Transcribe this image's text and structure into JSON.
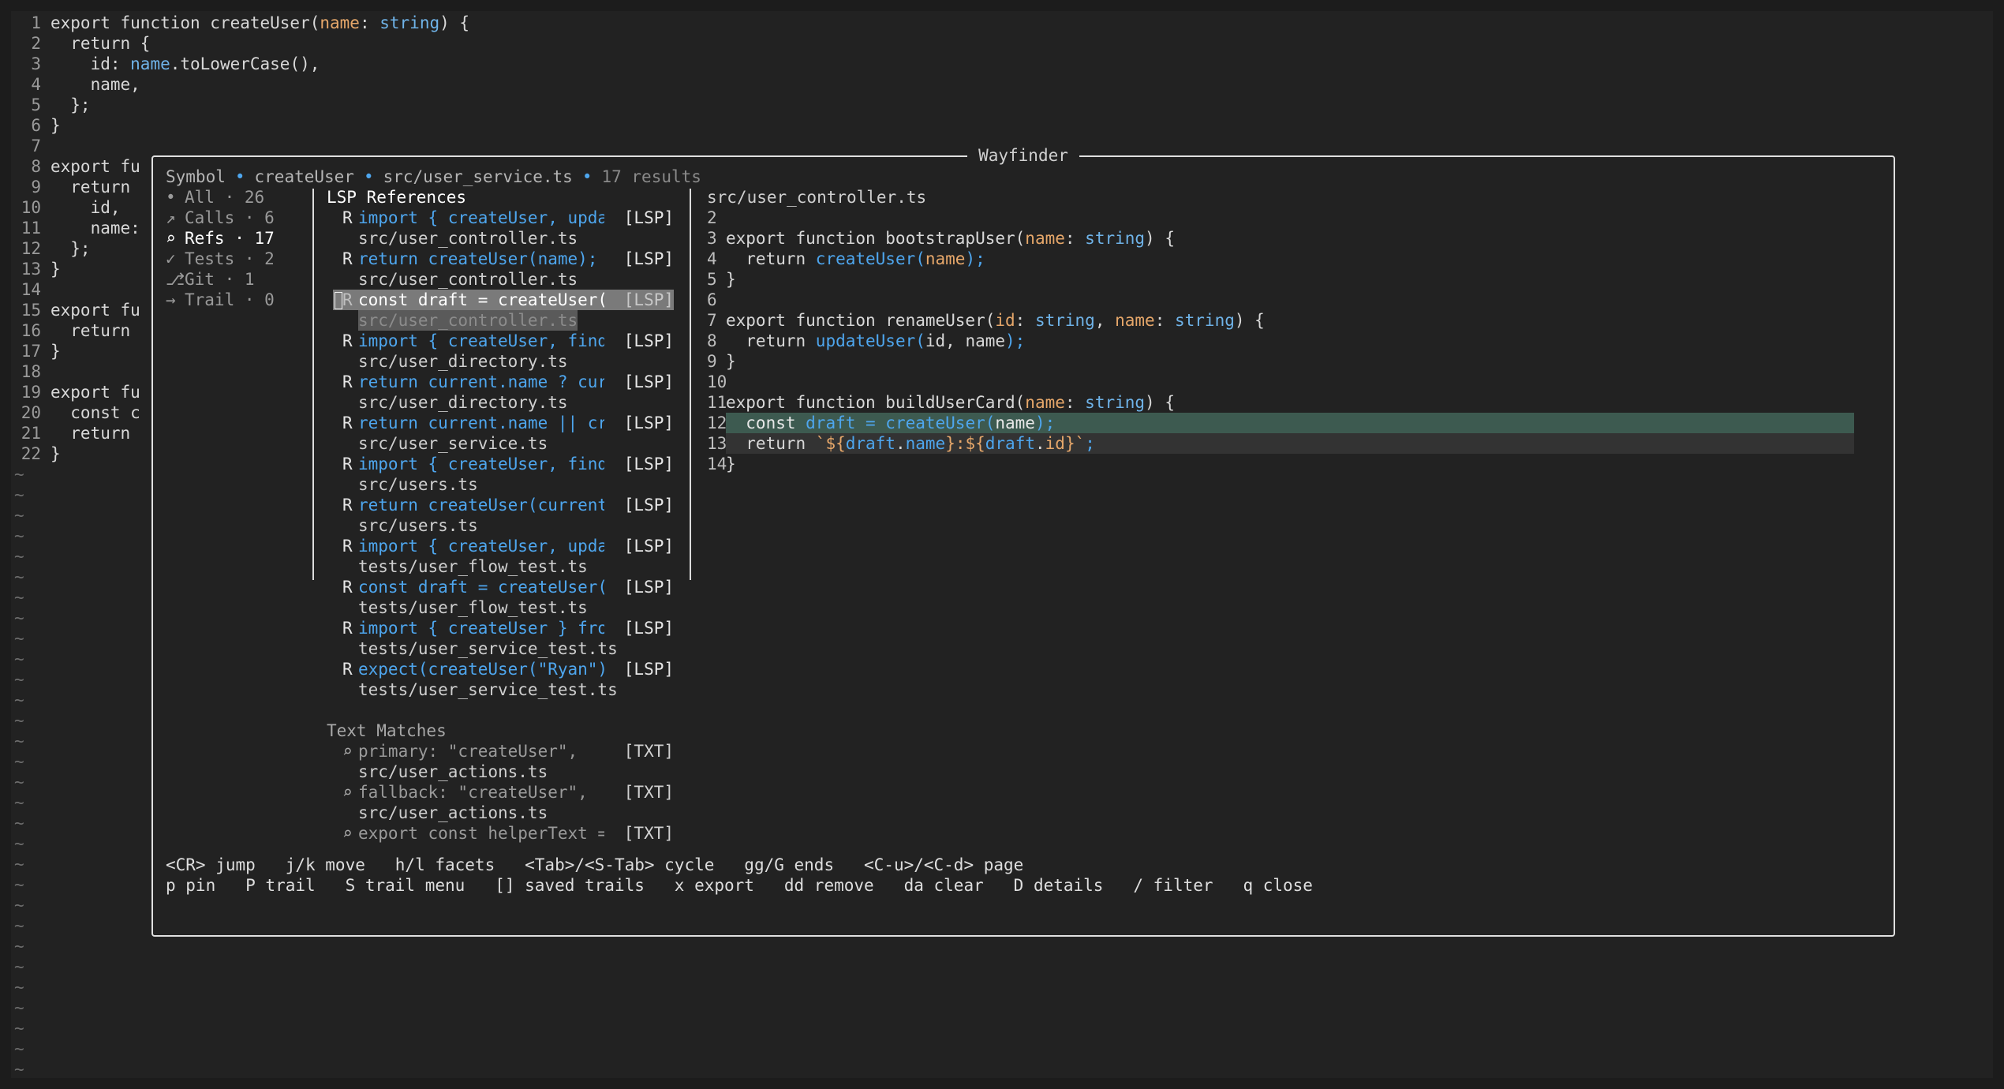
{
  "editor": {
    "lines": [
      {
        "n": "1",
        "html": "export function createUser(<span class=\"param\">name</span>: <span class=\"type\">string</span>) {"
      },
      {
        "n": "2",
        "html": "  return {"
      },
      {
        "n": "3",
        "html": "    id: <span class=\"prop\">name</span>.toLowerCase(),"
      },
      {
        "n": "4",
        "html": "    name,"
      },
      {
        "n": "5",
        "html": "  };"
      },
      {
        "n": "6",
        "html": "}"
      },
      {
        "n": "7",
        "html": ""
      },
      {
        "n": "8",
        "html": "export fu"
      },
      {
        "n": "9",
        "html": "  return"
      },
      {
        "n": "10",
        "html": "    id,"
      },
      {
        "n": "11",
        "html": "    name:"
      },
      {
        "n": "12",
        "html": "  };"
      },
      {
        "n": "13",
        "html": "}"
      },
      {
        "n": "14",
        "html": ""
      },
      {
        "n": "15",
        "html": "export fu"
      },
      {
        "n": "16",
        "html": "  return"
      },
      {
        "n": "17",
        "html": "}"
      },
      {
        "n": "18",
        "html": ""
      },
      {
        "n": "19",
        "html": "export fu"
      },
      {
        "n": "20",
        "html": "  const c"
      },
      {
        "n": "21",
        "html": "  return"
      },
      {
        "n": "22",
        "html": "}"
      }
    ],
    "tilde": "~",
    "tilde_count": 31
  },
  "wayfinder": {
    "title": "Wayfinder",
    "header": {
      "kind": "Symbol",
      "symbol": "createUser",
      "file": "src/user_service.ts",
      "results": "17 results",
      "sep": "•"
    },
    "facets": [
      {
        "glyph": "•",
        "label": "All · 26",
        "active": false
      },
      {
        "glyph": "↗",
        "label": "Calls · 6",
        "active": false
      },
      {
        "glyph": "⌕",
        "label": "Refs · 17",
        "active": true
      },
      {
        "glyph": "✓",
        "label": "Tests · 2",
        "active": false
      },
      {
        "glyph": "⎇",
        "label": "Git · 1",
        "active": false
      },
      {
        "glyph": "→",
        "label": "Trail · 0",
        "active": false
      }
    ],
    "lsp_section": "LSP References",
    "text_section": "Text Matches",
    "refs": [
      {
        "tag": "R",
        "text": "import { createUser, upda…",
        "src": "[LSP]",
        "file": "src/user_controller.ts",
        "selected": false
      },
      {
        "tag": "R",
        "text": "return createUser(name);",
        "src": "[LSP]",
        "file": "src/user_controller.ts",
        "selected": false
      },
      {
        "tag": "R",
        "text": "const draft = createUser(…",
        "src": "[LSP]",
        "file": "src/user_controller.ts",
        "selected": true
      },
      {
        "tag": "R",
        "text": "import { createUser, find…",
        "src": "[LSP]",
        "file": "src/user_directory.ts",
        "selected": false
      },
      {
        "tag": "R",
        "text": "return current.name ? cur…",
        "src": "[LSP]",
        "file": "src/user_directory.ts",
        "selected": false
      },
      {
        "tag": "R",
        "text": "return current.name || cr…",
        "src": "[LSP]",
        "file": "src/user_service.ts",
        "selected": false
      },
      {
        "tag": "R",
        "text": "import { createUser, find…",
        "src": "[LSP]",
        "file": "src/users.ts",
        "selected": false
      },
      {
        "tag": "R",
        "text": "return createUser(current…",
        "src": "[LSP]",
        "file": "src/users.ts",
        "selected": false
      },
      {
        "tag": "R",
        "text": "import { createUser, upda…",
        "src": "[LSP]",
        "file": "tests/user_flow_test.ts",
        "selected": false
      },
      {
        "tag": "R",
        "text": "const draft = createUser(…",
        "src": "[LSP]",
        "file": "tests/user_flow_test.ts",
        "selected": false
      },
      {
        "tag": "R",
        "text": "import { createUser } fro…",
        "src": "[LSP]",
        "file": "tests/user_service_test.ts",
        "selected": false
      },
      {
        "tag": "R",
        "text": "expect(createUser(\"Ryan\")…",
        "src": "[LSP]",
        "file": "tests/user_service_test.ts",
        "selected": false
      }
    ],
    "text_matches": [
      {
        "tag": "⌕",
        "text": "primary: \"createUser\",",
        "src": "[TXT]",
        "file": "src/user_actions.ts"
      },
      {
        "tag": "⌕",
        "text": "fallback: \"createUser\",",
        "src": "[TXT]",
        "file": "src/user_actions.ts"
      },
      {
        "tag": "⌕",
        "text": "export const helperText =…",
        "src": "[TXT]",
        "file": ""
      }
    ],
    "preview": {
      "file": "src/user_controller.ts",
      "lines": [
        {
          "n": "2",
          "html": ""
        },
        {
          "n": "3",
          "html": "export function bootstrapUser(<span class=\"param\">name</span>: <span class=\"type\">string</span>) {"
        },
        {
          "n": "4",
          "html": "  return <span class=\"blue\">createUser(</span><span class=\"param\">name</span><span class=\"blue\">);</span>"
        },
        {
          "n": "5",
          "html": "}"
        },
        {
          "n": "6",
          "html": ""
        },
        {
          "n": "7",
          "html": "export function renameUser(<span class=\"param\">id</span>: <span class=\"type\">string</span>, <span class=\"param\">name</span>: <span class=\"type\">string</span>) {"
        },
        {
          "n": "8",
          "html": "  return <span class=\"blue\">updateUser(</span>id, name<span class=\"blue\">);</span>"
        },
        {
          "n": "9",
          "html": "}"
        },
        {
          "n": "10",
          "html": ""
        },
        {
          "n": "11",
          "html": "export function buildUserCard(<span class=\"param\">name</span>: <span class=\"type\">string</span>) {"
        },
        {
          "n": "12",
          "html": "  const <span class=\"blue\">draft = createUser(</span>name<span class=\"blue\">);</span>",
          "hl": "hl1"
        },
        {
          "n": "13",
          "html": "  return <span class=\"str\">`${</span><span class=\"blue\">draft</span>.<span class=\"blue\">name</span><span class=\"str\">}:${</span><span class=\"blue\">draft</span>.<span class=\"param\">id</span><span class=\"str\">}`</span><span class=\"blue\">;</span>",
          "hl": "hl2"
        },
        {
          "n": "14",
          "html": "}"
        }
      ]
    },
    "help": [
      "<CR> jump   j/k move   h/l facets   <Tab>/<S-Tab> cycle   gg/G ends   <C-u>/<C-d> page",
      "p pin   P trail   S trail menu   [] saved trails   x export   dd remove   da clear   D details   / filter   q close"
    ]
  }
}
